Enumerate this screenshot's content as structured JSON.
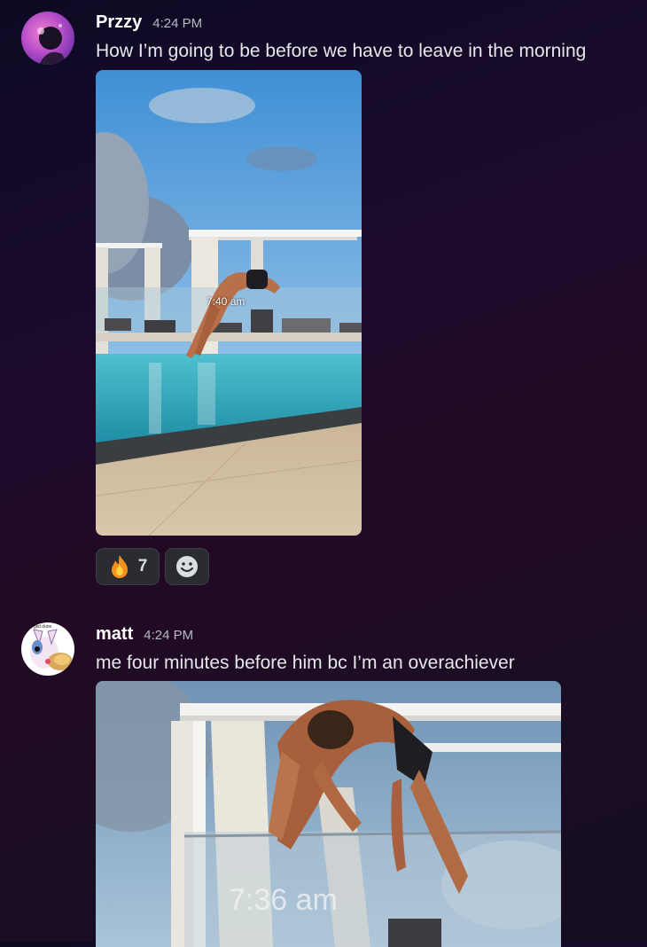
{
  "messages": [
    {
      "username": "Przzy",
      "timestamp": "4:24 PM",
      "content": "How I’m going to be before we have to leave in the morning",
      "attachment": {
        "overlay_text": "7:40 am"
      },
      "reactions": [
        {
          "emoji": "🔥",
          "icon": "fire-icon",
          "count": "7"
        }
      ],
      "add_reaction_icon": "smiley-add-reaction-icon"
    },
    {
      "username": "matt",
      "timestamp": "4:24 PM",
      "content": "me four minutes before him bc I’m an overachiever",
      "avatar_caption": "glid dune",
      "attachment": {
        "overlay_text": "7:36 am"
      }
    }
  ],
  "colors": {
    "background_start": "#0e0a24",
    "background_end": "#230a24",
    "username": "#ffffff",
    "timestamp": "#b5bac1",
    "reaction_bg": "#2a2c31"
  }
}
